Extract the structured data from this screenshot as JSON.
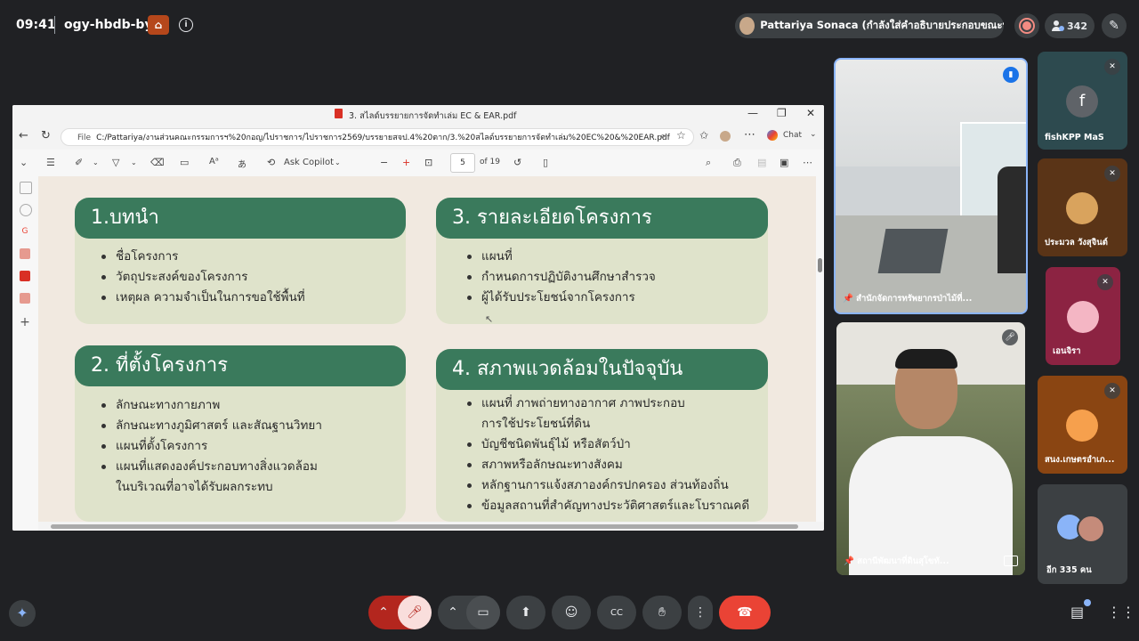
{
  "topbar": {
    "time": "09:41",
    "meeting_code": "ogy-hbdb-byc",
    "presenter_chip": "Pattariya Sonaca (กำลังใส่คำอธิบายประกอบขณะนำเสนอ)",
    "people_count": "342"
  },
  "window": {
    "title": "3. สไลด์บรรยายการจัดทำเล่ม EC & EAR.pdf",
    "address_prefix": "File",
    "address": "C:/Pattariya/งานส่วนคณะกรรมการฯ%20กอญ/ไปราชการ/ไปราชการ2569/บรรยายสจป.4%20ตาก/3.%20สไลด์บรรยายการจัดทำเล่ม%20EC%20&%20EAR.pdf",
    "chat_label": "Chat",
    "ask_copilot": "Ask Copilot",
    "page_current": "5",
    "page_total": "of 19"
  },
  "slide": {
    "sections": [
      {
        "title": "1.บทนำ",
        "items": [
          "ชื่อโครงการ",
          "วัตถุประสงค์ของโครงการ",
          "เหตุผล ความจำเป็นในการขอใช้พื้นที่"
        ]
      },
      {
        "title": "3. รายละเอียดโครงการ",
        "items": [
          "แผนที่",
          "กำหนดการปฏิบัติงานศึกษาสำรวจ",
          "ผู้ได้รับประโยชน์จากโครงการ"
        ]
      },
      {
        "title": "2. ที่ตั้งโครงการ",
        "items": [
          "ลักษณะทางกายภาพ",
          "ลักษณะทางภูมิศาสตร์ และสัณฐานวิทยา",
          "แผนที่ตั้งโครงการ",
          "แผนที่แสดงองค์ประกอบทางสิ่งแวดล้อม",
          "ในบริเวณที่อาจได้รับผลกระทบ"
        ]
      },
      {
        "title": "4. สภาพแวดล้อมในปัจจุบัน",
        "items": [
          "แผนที่ ภาพถ่ายทางอากาศ ภาพประกอบ",
          "การใช้ประโยชน์ที่ดิน",
          "บัญชีชนิดพันธุ์ไม้ หรือสัตว์ป่า",
          "สภาพหรือลักษณะทางสังคม",
          "หลักฐานการแจ้งสภาองค์กรปกครอง ส่วนท้องถิ่น",
          "ข้อมูลสถานที่สำคัญทางประวัติศาสตร์และโบราณคดี"
        ]
      }
    ]
  },
  "participants": {
    "room_tile": "สำนักจัดการทรัพยากรป่าไม้ที่...",
    "man_tile": "สถานีพัฒนาที่ดินสุโขทั...",
    "fish": {
      "initial": "f",
      "name": "fishKPP MaS"
    },
    "prasan": "ประมวล วังสุจินต์",
    "enjira": "เอนจิรา",
    "office": "สนง.เกษตรอำเภ...",
    "others": "อีก 335 คน"
  },
  "colors": {
    "slide_bg": "#f1e9e0",
    "card_bg": "#dfe3cb",
    "header_green": "#3a7a5c",
    "end_call": "#ea4335",
    "mic_off_bg": "#f9dedc",
    "raise_accent": "#8ab4f8"
  }
}
